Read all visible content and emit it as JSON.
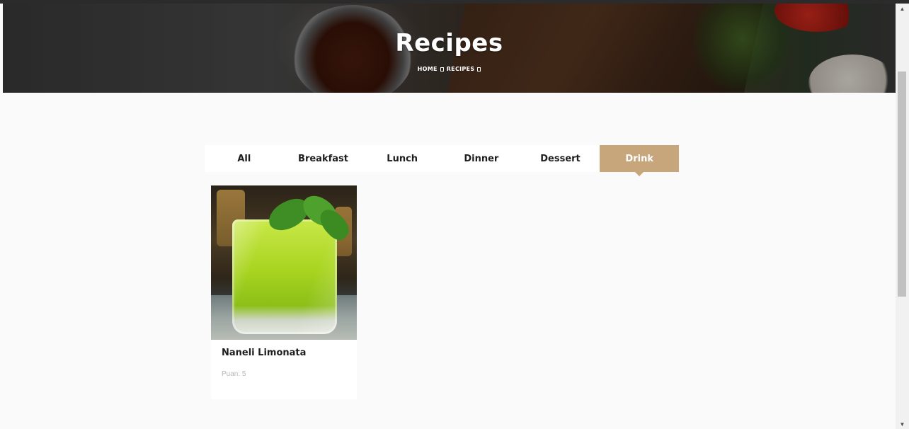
{
  "hero": {
    "title": "Recipes",
    "breadcrumb": [
      {
        "label": "HOME"
      },
      {
        "label": "RECIPES"
      }
    ]
  },
  "tabs": [
    {
      "label": "All",
      "active": false
    },
    {
      "label": "Breakfast",
      "active": false
    },
    {
      "label": "Lunch",
      "active": false
    },
    {
      "label": "Dinner",
      "active": false
    },
    {
      "label": "Dessert",
      "active": false
    },
    {
      "label": "Drink",
      "active": true
    }
  ],
  "recipes": [
    {
      "title": "Naneli Limonata",
      "score_label": "Puan: 5"
    }
  ],
  "colors": {
    "accent": "#c8a67c",
    "page_background": "#fafafa"
  },
  "icons": {
    "breadcrumb_separator": "square-glyph-icon",
    "scroll_up": "triangle-up-icon",
    "scroll_down": "triangle-down-icon"
  }
}
